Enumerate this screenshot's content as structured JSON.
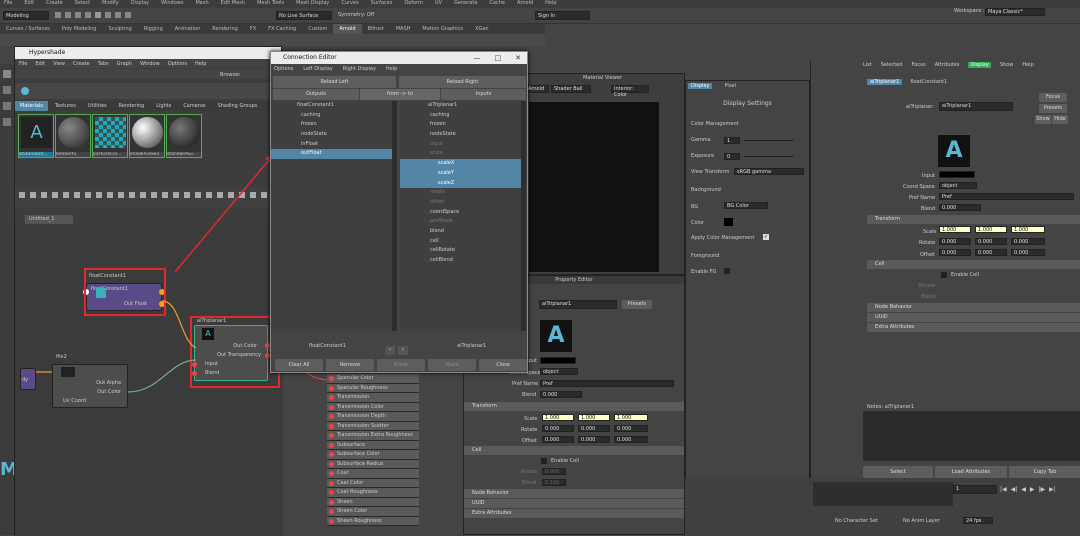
{
  "main_menu": [
    "File",
    "Edit",
    "Create",
    "Select",
    "Modify",
    "Display",
    "Windows",
    "Mesh",
    "Edit Mesh",
    "Mesh Tools",
    "Mesh Display",
    "Curves",
    "Surfaces",
    "Deform",
    "UV",
    "Generate",
    "Cache",
    "Arnold",
    "Help"
  ],
  "workspace_label": "Workspace :",
  "workspace_value": "Maya Classic*",
  "mode_value": "Modeling",
  "no_live_surface": "No Live Surface",
  "symmetry": "Symmetry: Off",
  "sign_in": "Sign In",
  "shelf_tabs": [
    "Curves / Surfaces",
    "Poly Modeling",
    "Sculpting",
    "Rigging",
    "Animation",
    "Rendering",
    "FX",
    "FX Caching",
    "Custom",
    "Arnold",
    "Bifrost",
    "MASH",
    "Motion Graphics",
    "XGen"
  ],
  "shelf_active": "Arnold",
  "hypershade": {
    "title": "Hypershade",
    "menu": [
      "File",
      "Edit",
      "View",
      "Create",
      "Tabs",
      "Graph",
      "Window",
      "Options",
      "Help"
    ],
    "browser_label": "Browser",
    "browser_tabs": [
      "Materials",
      "Textures",
      "Utilities",
      "Rendering",
      "Lights",
      "Cameras",
      "Shading Groups"
    ],
    "swatches": [
      "aiStandard...",
      "lambert1",
      "particleClo...",
      "shaderGlow1",
      "standardSu..."
    ],
    "graph_tab": "Untitled_1",
    "float_node": {
      "title": "floatConstant1",
      "port": "Out Float"
    },
    "triplanar_node": {
      "title": "aiTriplanar1",
      "ports": [
        "Out Color",
        "Out Transparency",
        "Input",
        "Blend"
      ]
    },
    "file_node": {
      "title": "file2",
      "ports": [
        "Out Alpha",
        "Out Color",
        "Uv Coord"
      ]
    },
    "partial_label": "dy",
    "shader_ports": [
      "Specular Color",
      "Specular Roughness",
      "Transmission",
      "Transmission Color",
      "Transmission Depth",
      "Transmission Scatter",
      "Transmission Extra Roughness",
      "Subsurface",
      "Subsurface Color",
      "Subsurface Radius",
      "Coat",
      "Coat Color",
      "Coat Roughness",
      "Sheen",
      "Sheen Color",
      "Sheen Roughness"
    ]
  },
  "connection_editor": {
    "title": "Connection Editor",
    "menu": [
      "Options",
      "Left Display",
      "Right Display",
      "Help"
    ],
    "reload_left": "Reload Left",
    "reload_right": "Reload Right",
    "outputs": "Outputs",
    "from_to": "from -> to",
    "inputs": "Inputs",
    "left_header": "floatConstant1",
    "left_items": [
      "caching",
      "frozen",
      "nodeState",
      "inFloat",
      "outFloat"
    ],
    "left_selected": "outFloat",
    "right_header": "aiTriplanar1",
    "right_items": [
      "caching",
      "frozen",
      "nodeState",
      "input",
      "scale",
      "scaleX",
      "scaleY",
      "scaleZ",
      "rotate",
      "offset",
      "coordSpace",
      "prefNode",
      "blend",
      "cell",
      "cellRotate",
      "cellBlend"
    ],
    "right_selected": [
      "scaleX",
      "scaleY",
      "scaleZ"
    ],
    "right_dimmed": [
      "input",
      "scale",
      "rotate",
      "offset",
      "prefNode"
    ],
    "left_footer": "floatConstant1",
    "right_footer": "aiTriplanar1",
    "buttons": [
      "Clear All",
      "Remove",
      "Break",
      "Make",
      "Close"
    ]
  },
  "render_view": {
    "title": "Material Viewer",
    "renderer": "Arnold",
    "shader_ball": "Shader Ball",
    "interior": "Interior: Color"
  },
  "display_settings": {
    "tabs": [
      "Display",
      "Pixel"
    ],
    "title": "Display Settings",
    "color_mgmt": "Color Management",
    "gamma_label": "Gamma",
    "gamma_value": "1",
    "exposure_label": "Exposure",
    "exposure_value": "0",
    "view_transform_label": "View Transform",
    "view_transform_value": "sRGB gamma",
    "background": "Background",
    "bg_label": "BG",
    "bg_value": "BG Color",
    "color_label": "Color",
    "apply_cm": "Apply Color Management",
    "foreground": "Foreground",
    "enable_fg": "Enable FG"
  },
  "property_editor": {
    "title": "Property Editor",
    "node_name": "aiTriplanar1",
    "presets": "Presets",
    "input_label": "Input",
    "coord_space_label": "Coord Space",
    "coord_space_value": "object",
    "pref_name_label": "Pref Name",
    "pref_name_value": "Pref",
    "blend_label": "Blend",
    "blend_value": "0.000",
    "transform": "Transform",
    "scale_label": "Scale",
    "scale_values": [
      "1.000",
      "1.000",
      "1.000"
    ],
    "rotate_label": "Rotate",
    "rotate_values": [
      "0.000",
      "0.000",
      "0.000"
    ],
    "offset_label": "Offset",
    "offset_values": [
      "0.000",
      "0.000",
      "0.000"
    ],
    "cell": "Cell",
    "enable_cell": "Enable Cell",
    "rotate_value": "0.000",
    "cell_blend_value": "0.100",
    "node_behavior": "Node Behavior",
    "uuid": "UUID",
    "extra_attributes": "Extra Attributes"
  },
  "attribute_editor": {
    "menu": [
      "List",
      "Selected",
      "Focus",
      "Attributes",
      "Display",
      "Show",
      "Help"
    ],
    "tabs": [
      "aiTriplanar1",
      "floatConstant1"
    ],
    "node_label": "aiTriplanar:",
    "node_name": "aiTriplanar1",
    "focus": "Focus",
    "presets": "Presets",
    "show": "Show",
    "hide": "Hide",
    "notes": "Notes: aiTriplanar1",
    "buttons": [
      "Select",
      "Load Attributes",
      "Copy Tab"
    ]
  },
  "timeline": {
    "frame": "1",
    "no_character_set": "No Character Set",
    "no_anim_layer": "No Anim Layer",
    "fps": "24 fps"
  }
}
